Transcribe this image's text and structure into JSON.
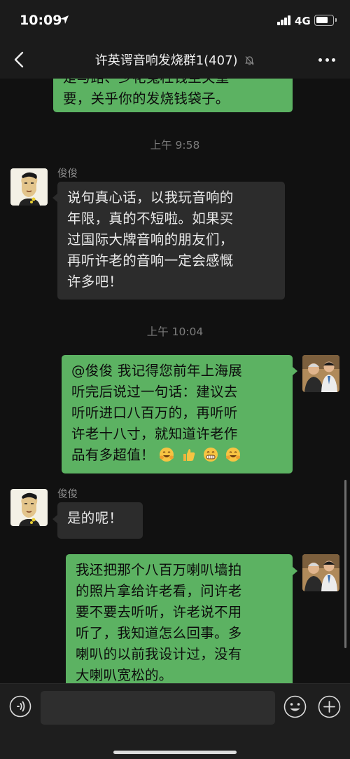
{
  "status_bar": {
    "time": "10:09",
    "network": "4G"
  },
  "nav": {
    "title": "许英谔音响发烧群1(407)"
  },
  "messages": [
    {
      "side": "right",
      "lines": [
        "是与路、少花冤枉钱至关重",
        "要，关乎你的发烧钱袋子。"
      ]
    },
    {
      "timestamp": "上午 9:58"
    },
    {
      "side": "left",
      "sender": "俊俊",
      "lines": [
        "说句真心话，以我玩音响的",
        "年限，真的不短啦。如果买",
        "过国际大牌音响的朋友们，",
        "再听许老的音响一定会感慨",
        "许多吧！"
      ]
    },
    {
      "timestamp": "上午 10:04"
    },
    {
      "side": "right",
      "lines": [
        "@俊俊 我记得您前年上海展",
        "听完后说过一句话：建议去",
        "听听进口八百万的，再听听",
        "许老十八寸，就知道许老作",
        "品有多超值！"
      ],
      "emojis": [
        "grin-sweat-emoji",
        "thumbs-up-emoji",
        "grimace-emoji",
        "grin-sweat-emoji"
      ]
    },
    {
      "side": "left",
      "sender": "俊俊",
      "lines": [
        "是的呢！"
      ]
    },
    {
      "side": "right",
      "lines": [
        "我还把那个八百万喇叭墙拍",
        "的照片拿给许老看，问许老",
        "要不要去听听，许老说不用",
        "听了，我知道怎么回事。多",
        "喇叭的以前我设计过，没有",
        "大喇叭宽松的。"
      ]
    }
  ],
  "colors": {
    "bubble_sent": "#5cb262",
    "bubble_received": "#2c2c2c",
    "background": "#111111"
  },
  "icons": {
    "back": "chevron-left-icon",
    "mute": "bell-slash-icon",
    "more": "more-dots-icon",
    "voice": "voice-icon",
    "emoji": "emoji-icon",
    "plus": "plus-icon"
  }
}
